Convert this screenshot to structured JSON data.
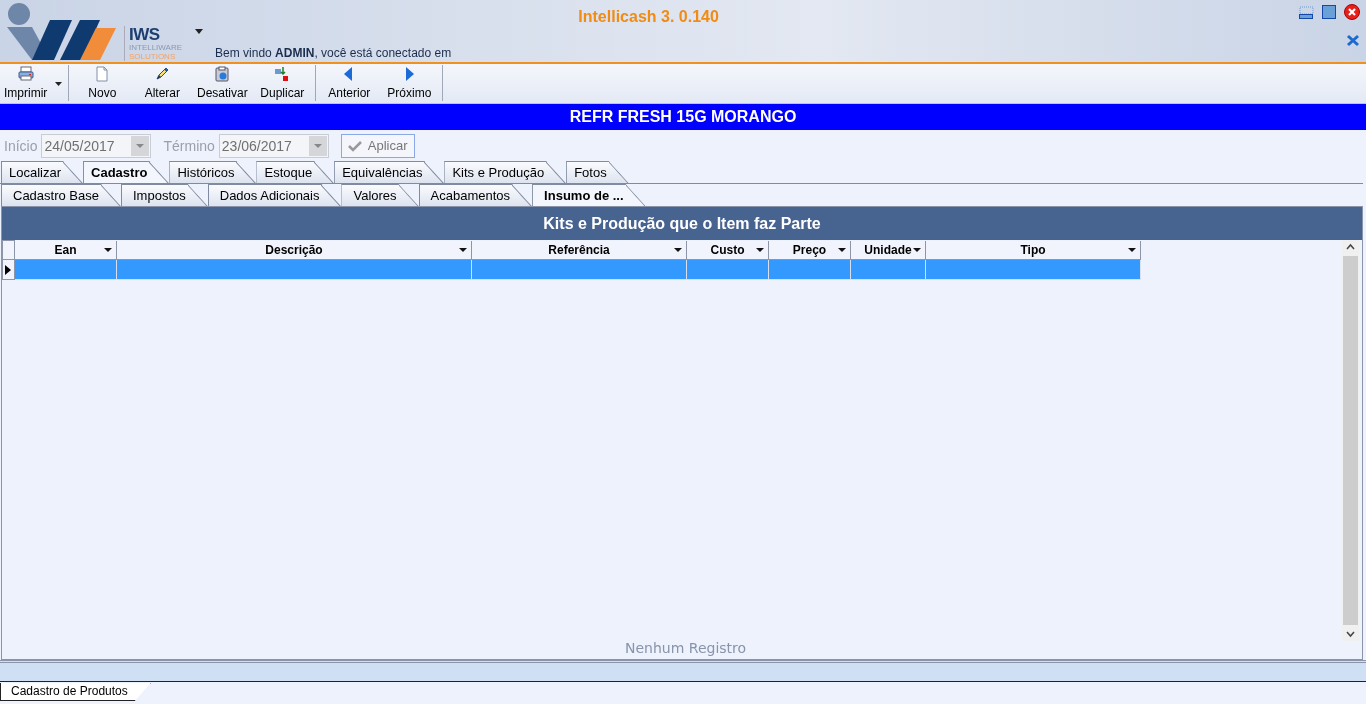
{
  "window": {
    "title": "Intellicash 3. 0.140"
  },
  "logo": {
    "name": "IWS",
    "line1": "INTELLIWARE",
    "line2": "SOLUTIONS"
  },
  "welcome": "Bem vindo **ADMIN**, você está conectado em",
  "toolbar": [
    {
      "buttons": [
        {
          "label": "Imprimir",
          "kind": "print",
          "dropdown": true
        }
      ]
    },
    {
      "buttons": [
        {
          "label": "Novo",
          "kind": "new",
          "dropdown": false
        },
        {
          "label": "Alterar",
          "kind": "edit",
          "dropdown": false
        },
        {
          "label": "Desativar",
          "kind": "disable",
          "dropdown": false
        },
        {
          "label": "Duplicar",
          "kind": "duplicate",
          "dropdown": false
        }
      ]
    },
    {
      "buttons": [
        {
          "label": "Anterior",
          "kind": "prev",
          "dropdown": false
        },
        {
          "label": "Próximo",
          "kind": "next",
          "dropdown": false
        }
      ]
    }
  ],
  "banner": "REFR FRESH 15G MORANGO",
  "filter": {
    "start_label": "Início",
    "start_value": "24/05/2017",
    "end_label": "Término",
    "end_value": "23/06/2017",
    "apply": "Aplicar",
    "disabled": true
  },
  "tabs": [
    {
      "label": "Localizar",
      "selected": false
    },
    {
      "label": "Cadastro",
      "selected": true
    },
    {
      "label": "Históricos",
      "selected": false
    },
    {
      "label": "Estoque",
      "selected": false
    },
    {
      "label": "Equivalências",
      "selected": false
    },
    {
      "label": "Kits e Produção",
      "selected": false
    },
    {
      "label": "Fotos",
      "selected": false
    }
  ],
  "subtabs": [
    {
      "label": "Cadastro Base",
      "selected": false
    },
    {
      "label": "Impostos",
      "selected": false
    },
    {
      "label": "Dados Adicionais",
      "selected": false
    },
    {
      "label": "Valores",
      "selected": false
    },
    {
      "label": "Acabamentos",
      "selected": false
    },
    {
      "label": "Insumo de ...",
      "selected": true
    }
  ],
  "grid": {
    "title": "Kits e Produção que o Item faz Parte",
    "columns": [
      "Ean",
      "Descrição",
      "Referência",
      "Custo",
      "Preço",
      "Unidade",
      "Tipo"
    ],
    "rows": [
      {
        "selected": true
      }
    ],
    "empty_message": "Nenhum Registro"
  },
  "bottom_tabs": [
    {
      "label": "Cadastro de Produtos",
      "selected": true
    }
  ]
}
